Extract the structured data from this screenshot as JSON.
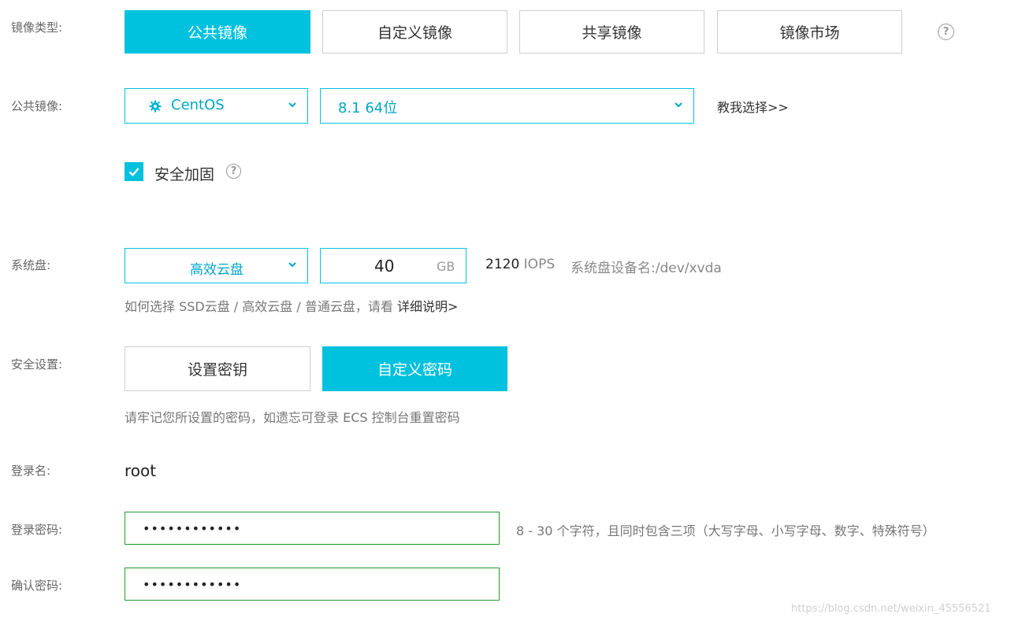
{
  "image_type": {
    "label": "镜像类型:",
    "tabs": [
      {
        "label": "公共镜像",
        "active": true
      },
      {
        "label": "自定义镜像",
        "active": false
      },
      {
        "label": "共享镜像",
        "active": false
      },
      {
        "label": "镜像市场",
        "active": false
      }
    ]
  },
  "public_image": {
    "label": "公共镜像:",
    "os": "CentOS",
    "version": "8.1 64位",
    "guide_link": "教我选择>>"
  },
  "security_hardening": {
    "label": "安全加固",
    "checked": true
  },
  "system_disk": {
    "label": "系统盘:",
    "type": "高效云盘",
    "size": "40",
    "unit": "GB",
    "iops_value": "2120",
    "iops_unit": "IOPS",
    "device_label": "系统盘设备名:",
    "device_name": "/dev/xvda",
    "hint_prefix": "如何选择 SSD云盘 / 高效云盘 / 普通云盘，请看",
    "hint_link": "详细说明>"
  },
  "security_settings": {
    "label": "安全设置:",
    "options": [
      {
        "label": "设置密钥",
        "active": false
      },
      {
        "label": "自定义密码",
        "active": true
      }
    ],
    "hint": "请牢记您所设置的密码，如遗忘可登录 ECS 控制台重置密码"
  },
  "login": {
    "name_label": "登录名:",
    "name_value": "root",
    "password_label": "登录密码:",
    "password_mask": "••••••••••••",
    "password_rule": "8 - 30 个字符，且同时包含三项（大写字母、小写字母、数字、特殊符号）",
    "confirm_label": "确认密码:",
    "confirm_mask": "••••••••••••"
  },
  "watermark": "https://blog.csdn.net/weixin_45556521",
  "colors": {
    "accent": "#00c1de",
    "valid_border": "#1f9b2a"
  },
  "icons": [
    "help-icon",
    "gear-icon",
    "chevron-down-icon",
    "checkbox-checked-icon"
  ]
}
